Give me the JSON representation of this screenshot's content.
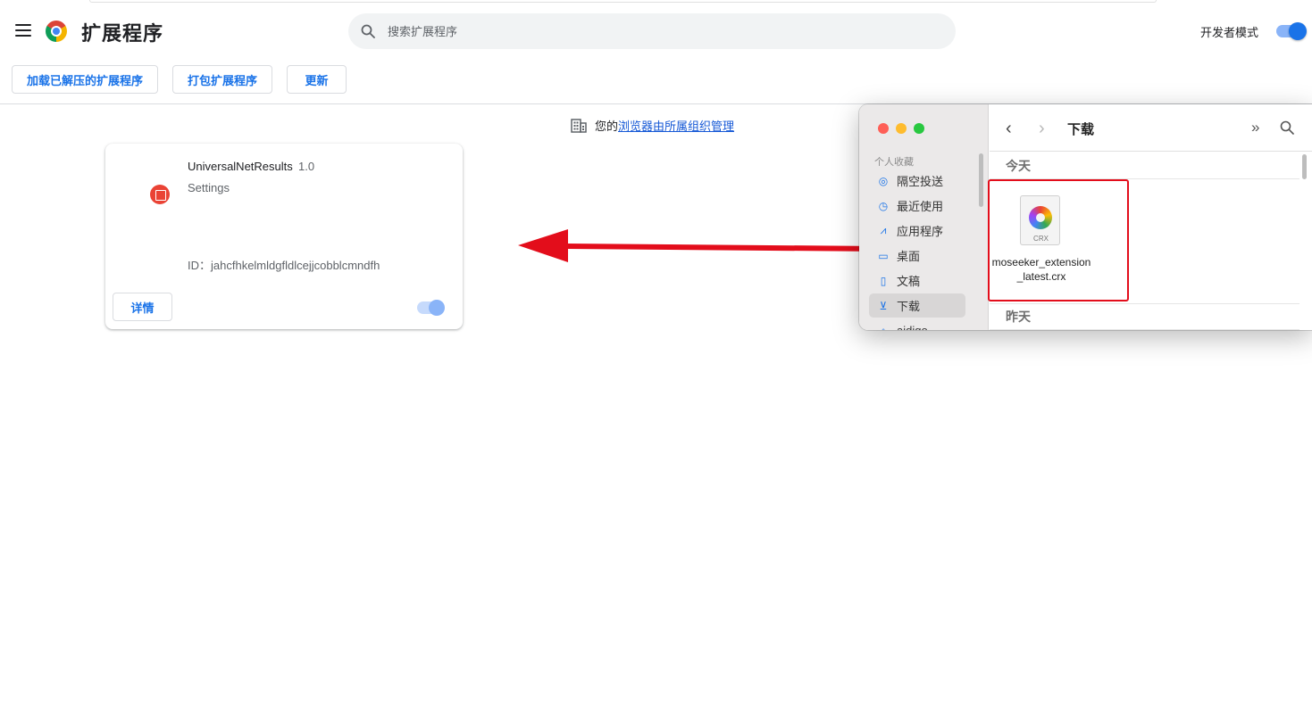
{
  "header": {
    "title": "扩展程序",
    "search_placeholder": "搜索扩展程序",
    "developer_mode_label": "开发者模式",
    "developer_mode_on": true
  },
  "toolbar": {
    "load_unpacked": "加载已解压的扩展程序",
    "pack_extension": "打包扩展程序",
    "update": "更新"
  },
  "managed_notice": {
    "prefix": "您的",
    "link": "浏览器由所属组织管理"
  },
  "extension": {
    "name": "UniversalNetResults",
    "version": "1.0",
    "description": "Settings",
    "id_text": "ID：jahcfhkelmldgfldlcejjcobblcmndfh",
    "details_label": "详情",
    "enabled": true
  },
  "finder": {
    "favorites_label": "个人收藏",
    "sidebar_items": [
      {
        "label": "隔空投送",
        "icon": "airdrop-icon"
      },
      {
        "label": "最近使用",
        "icon": "clock-icon"
      },
      {
        "label": "应用程序",
        "icon": "applications-icon"
      },
      {
        "label": "桌面",
        "icon": "desktop-icon"
      },
      {
        "label": "文稿",
        "icon": "document-icon"
      },
      {
        "label": "下载",
        "icon": "download-icon"
      },
      {
        "label": "aidigo",
        "icon": "home-icon"
      }
    ],
    "folder_title": "下载",
    "section_today": "今天",
    "section_yesterday": "昨天",
    "file": {
      "name": "moseeker_extension_latest.crx",
      "type_label": "CRX"
    }
  },
  "colors": {
    "accent": "#1a73e8",
    "highlight_border": "#e30d1b",
    "arrow": "#e30d1b"
  }
}
